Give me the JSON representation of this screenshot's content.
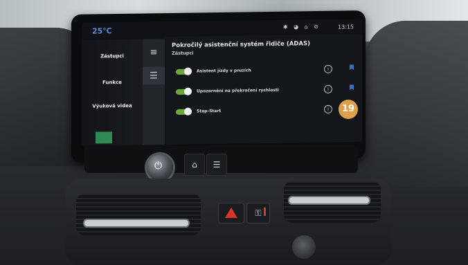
{
  "statusbar": {
    "temperature": "25℃",
    "icons": "✱ ◕ ⌂ ⊘",
    "time": "13:15"
  },
  "nav": {
    "items": [
      {
        "label": "Zástupci"
      },
      {
        "label": "Funkce"
      },
      {
        "label": "Výuková videa"
      }
    ]
  },
  "rail": {
    "menu_icon": "≡",
    "car_icon": "☰"
  },
  "content": {
    "title": "Pokročilý asistenční systém řidiče (ADAS)",
    "subtitle": "Zástupci",
    "rows": [
      {
        "label": "Asistent jízdy v pruzích",
        "enabled": true
      },
      {
        "label": "Upozornění na překročení rychlosti",
        "enabled": true
      },
      {
        "label": "Stop-Start",
        "enabled": true
      }
    ],
    "info_glyph": "i"
  },
  "badge": {
    "value": "19"
  },
  "controls": {
    "power_glyph": "⏻",
    "home_glyph": "⌂",
    "car_glyph": "☰",
    "lock_glyph": "⚿"
  },
  "colors": {
    "accent_blue": "#3e6fbf",
    "toggle_green": "#6ea83c",
    "badge_orange": "#e0a04a",
    "hazard_red": "#d8342c"
  }
}
